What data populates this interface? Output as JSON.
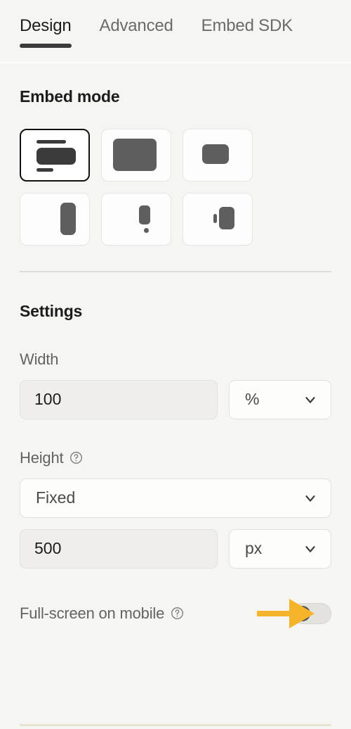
{
  "tabs": [
    {
      "label": "Design",
      "active": true
    },
    {
      "label": "Advanced",
      "active": false
    },
    {
      "label": "Embed SDK",
      "active": false
    }
  ],
  "embed_mode": {
    "title": "Embed mode",
    "options": [
      {
        "name": "inline",
        "selected": true
      },
      {
        "name": "full-page",
        "selected": false
      },
      {
        "name": "modal",
        "selected": false
      },
      {
        "name": "slide-in",
        "selected": false
      },
      {
        "name": "popover",
        "selected": false
      },
      {
        "name": "side-drawer",
        "selected": false
      }
    ]
  },
  "settings": {
    "title": "Settings",
    "width": {
      "label": "Width",
      "value": "100",
      "unit": "%"
    },
    "height": {
      "label": "Height",
      "help_icon": "question-circle-icon",
      "mode": "Fixed",
      "value": "500",
      "unit": "px"
    },
    "fullscreen_mobile": {
      "label": "Full-screen on mobile",
      "help_icon": "question-circle-icon",
      "enabled": false
    }
  },
  "annotation": {
    "type": "arrow",
    "color": "#f5b429",
    "points_to": "fullscreen-toggle"
  },
  "colors": {
    "background": "#f5f5f3",
    "accent": "#f5b429",
    "text_primary": "#1c1c1c",
    "text_secondary": "#636363",
    "glyph": "#5e5e5e"
  }
}
